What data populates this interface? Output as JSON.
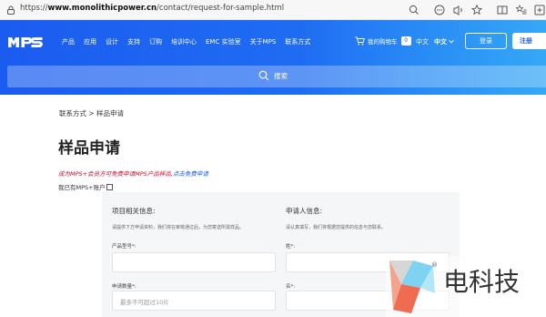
{
  "browser": {
    "url_prefix": "https://",
    "url_host": "www.monolithicpower.cn",
    "url_path": "/contact/request-for-sample.html"
  },
  "header": {
    "logo": "MPS",
    "nav": [
      "产品",
      "应用",
      "设计",
      "支持",
      "订购",
      "培训中心",
      "EMC 实验室",
      "关于MPS",
      "联系方式"
    ],
    "cart_label": "我的购物车",
    "cart_count": "0",
    "lang_option": "中文",
    "lang_selected": "中文",
    "login": "登录",
    "register": "注册",
    "search_placeholder": "搜索"
  },
  "breadcrumb": "联系方式 > 样品申请",
  "page_title": "样品申请",
  "promo_text": "成为MPS+会员方可免费申请MPS产品样品,",
  "promo_link": "点击免费申请",
  "account_label": "我已有MPS+账户",
  "form": {
    "left_title": "项目相关信息:",
    "left_desc": "请提供下方申请资料，我们将在审核通过后，为您寄送所需样品。",
    "product_label": "产品型号*:",
    "quantity_label": "申请数量*:",
    "quantity_placeholder": "最多不可超过10片",
    "right_title": "申请人信息:",
    "right_desc": "请认真填写，我们将根据您提供的信息与您联系。",
    "lastname_label": "姓*:",
    "firstname_label": "名*:"
  },
  "watermark": {
    "text": "电科技",
    "registered": "®"
  },
  "colors": {
    "brand_blue": "#1b5cf0",
    "promo_red": "#c8102e",
    "panel_bg": "#f5f6f8"
  }
}
